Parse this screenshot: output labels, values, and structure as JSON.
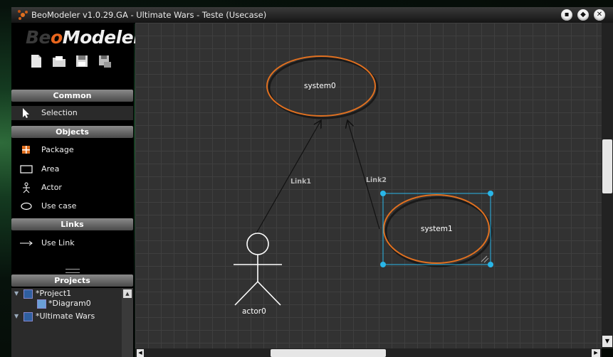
{
  "window": {
    "title": "BeoModeler v1.0.29.GA - Ultimate Wars - Teste (Usecase)"
  },
  "logo": {
    "beo_prefix": "Be",
    "beo_o": "o",
    "modeler": "Modeler"
  },
  "toolbar": {
    "icons": [
      "new-file-icon",
      "open-folder-icon",
      "save-icon",
      "save-as-icon"
    ]
  },
  "palette": {
    "common_header": "Common",
    "selection_label": "Selection",
    "objects_header": "Objects",
    "objects": [
      {
        "label": "Package",
        "icon": "package-icon"
      },
      {
        "label": "Area",
        "icon": "area-icon"
      },
      {
        "label": "Actor",
        "icon": "actor-icon"
      },
      {
        "label": "Use case",
        "icon": "use-case-icon"
      }
    ],
    "links_header": "Links",
    "links": [
      {
        "label": "Use Link",
        "icon": "arrow-link-icon"
      }
    ]
  },
  "projects": {
    "header": "Projects",
    "tree": [
      {
        "label": "*Project1"
      },
      {
        "label": "*Diagram0"
      },
      {
        "label": "*Ultimate Wars"
      }
    ]
  },
  "diagram": {
    "usecases": [
      {
        "label": "system0"
      },
      {
        "label": "system1"
      }
    ],
    "actors": [
      {
        "label": "actor0"
      }
    ],
    "links": [
      {
        "label": "Link1"
      },
      {
        "label": "Link2"
      }
    ]
  },
  "colors": {
    "usecase_stroke": "#e07020",
    "selection": "#29b6e8",
    "logo_accent": "#e8661e"
  }
}
